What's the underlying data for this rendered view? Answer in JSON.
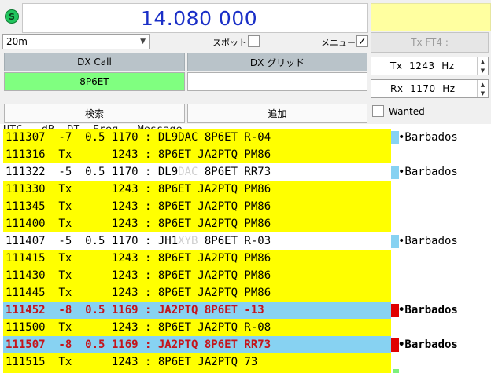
{
  "header": {
    "status_icon": "S",
    "frequency": "14.080 000"
  },
  "controls": {
    "band": "20m",
    "spot_label": "スポット",
    "spot_checked": false,
    "menu_label": "メニュー",
    "menu_checked": true,
    "tx_mode_button": "Tx FT4 :"
  },
  "dx": {
    "call_header": "DX Call",
    "grid_header": "DX グリッド",
    "call_value": "8P6ET",
    "grid_value": ""
  },
  "tx_offset": {
    "label": "Tx",
    "value": "1243",
    "unit": "Hz"
  },
  "rx_offset": {
    "label": "Rx",
    "value": "1170",
    "unit": "Hz"
  },
  "buttons": {
    "search": "検索",
    "add": "追加",
    "wanted_label": "Wanted",
    "wanted_checked": false
  },
  "decode_list": {
    "header": "UTC   dB  DT  Freq   Message",
    "rows": [
      {
        "utc": "111307",
        "db": "-7",
        "dt": "0.5",
        "freq": "1170",
        "msg": "DL9DAC 8P6ET R-04",
        "msg_call": "DL9DAC",
        "country": "•Barbados",
        "style": "partial"
      },
      {
        "utc": "111316",
        "db": "Tx",
        "dt": "",
        "freq": "1243",
        "msg": "8P6ET JA2PTQ PM86",
        "country": "",
        "style": "tx"
      },
      {
        "utc": "111322",
        "db": "-5",
        "dt": "0.5",
        "freq": "1170",
        "msg_prefix": "DL9",
        "msg_blur": "DAC",
        "msg_rest": " 8P6ET RR73",
        "country": "•Barbados",
        "style": "rx"
      },
      {
        "utc": "111330",
        "db": "Tx",
        "dt": "",
        "freq": "1243",
        "msg": "8P6ET JA2PTQ PM86",
        "country": "",
        "style": "tx"
      },
      {
        "utc": "111345",
        "db": "Tx",
        "dt": "",
        "freq": "1243",
        "msg": "8P6ET JA2PTQ PM86",
        "country": "",
        "style": "tx"
      },
      {
        "utc": "111400",
        "db": "Tx",
        "dt": "",
        "freq": "1243",
        "msg": "8P6ET JA2PTQ PM86",
        "country": "",
        "style": "tx"
      },
      {
        "utc": "111407",
        "db": "-5",
        "dt": "0.5",
        "freq": "1170",
        "msg_prefix": "JH1",
        "msg_blur": "XYB",
        "msg_rest": " 8P6ET R-03",
        "country": "•Barbados",
        "style": "rx"
      },
      {
        "utc": "111415",
        "db": "Tx",
        "dt": "",
        "freq": "1243",
        "msg": "8P6ET JA2PTQ PM86",
        "country": "",
        "style": "tx"
      },
      {
        "utc": "111430",
        "db": "Tx",
        "dt": "",
        "freq": "1243",
        "msg": "8P6ET JA2PTQ PM86",
        "country": "",
        "style": "tx"
      },
      {
        "utc": "111445",
        "db": "Tx",
        "dt": "",
        "freq": "1243",
        "msg": "8P6ET JA2PTQ PM86",
        "country": "",
        "style": "tx"
      },
      {
        "utc": "111452",
        "db": "-8",
        "dt": "0.5",
        "freq": "1169",
        "msg": "JA2PTQ 8P6ET -13",
        "country": "•Barbados",
        "style": "me"
      },
      {
        "utc": "111500",
        "db": "Tx",
        "dt": "",
        "freq": "1243",
        "msg": "8P6ET JA2PTQ R-08",
        "country": "",
        "style": "tx"
      },
      {
        "utc": "111507",
        "db": "-8",
        "dt": "0.5",
        "freq": "1169",
        "msg": "JA2PTQ 8P6ET RR73",
        "country": "•Barbados",
        "style": "me"
      },
      {
        "utc": "111515",
        "db": "Tx",
        "dt": "",
        "freq": "1243",
        "msg": "8P6ET JA2PTQ 73",
        "country": "",
        "style": "tx"
      }
    ]
  },
  "colors": {
    "frequency_text": "#1a2fc7",
    "tx_row": "#ffff00",
    "my_call_row": "#87d2f2",
    "my_call_text": "#c4141c",
    "dx_call_field": "#80ff80",
    "country_marker_normal": "#87d2f2",
    "country_marker_me": "#e00000",
    "header_button": "#b9c3c9"
  }
}
